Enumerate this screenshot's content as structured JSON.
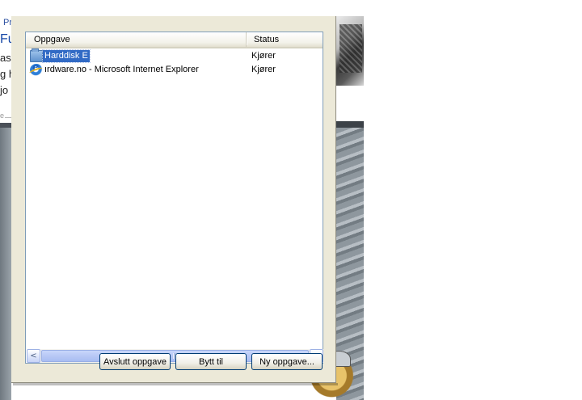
{
  "background": {
    "left_fragments": [
      "Pr",
      "Fu",
      "as",
      "g h",
      "jo",
      "e"
    ]
  },
  "task_list": {
    "columns": {
      "task": "Oppgave",
      "status": "Status"
    },
    "rows": [
      {
        "name": "Harddisk E",
        "status": "Kjører",
        "icon": "folder-icon",
        "selected": true
      },
      {
        "name": "ırdware.no - Microsoft Internet Explorer",
        "status": "Kjører",
        "icon": "ie-icon",
        "selected": false
      }
    ]
  },
  "scrollbar": {
    "left_arrow": "<",
    "right_arrow": ">"
  },
  "buttons": {
    "end_task": "Avslutt oppgave",
    "switch_to": "Bytt til",
    "new_task": "Ny oppgave..."
  },
  "colors": {
    "selection": "#316ac5",
    "dialog": "#ece9d8",
    "button_border": "#003c74"
  }
}
